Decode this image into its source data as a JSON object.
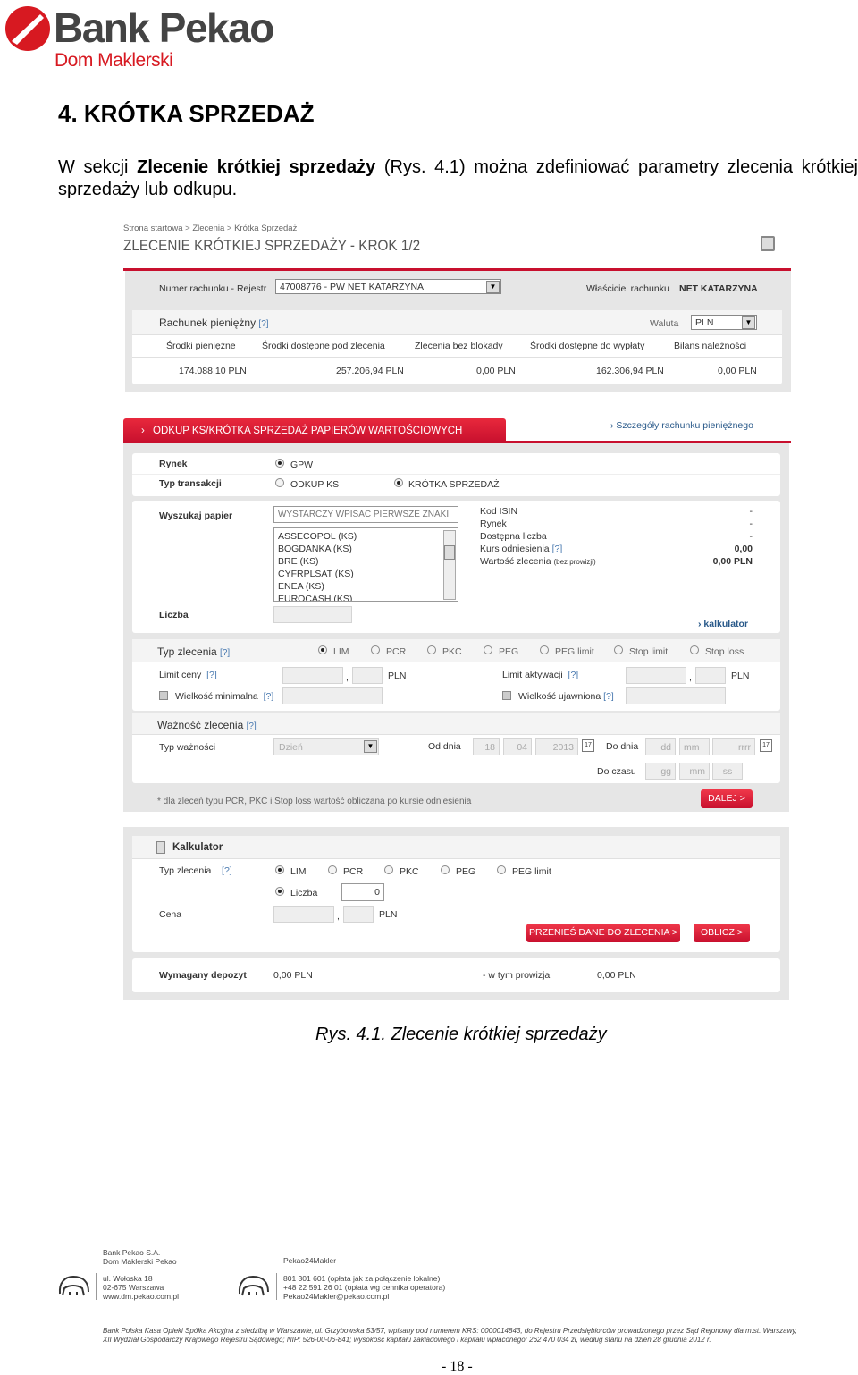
{
  "logo": {
    "brand": "Bank Pekao",
    "sub": "Dom Maklerski",
    "brand_color": "#d71921"
  },
  "heading": "4. KRÓTKA SPRZEDAŻ",
  "intro": {
    "pre": "W sekcji ",
    "bold": "Zlecenie krótkiej sprzedaży",
    "post": " (Rys. 4.1) można zdefiniować parametry zlecenia krótkiej sprzedaży lub odkupu."
  },
  "screen": {
    "breadcrumb": "Strona startowa > Zlecenia > Krótka Sprzedaż",
    "title": "ZLECENIE KRÓTKIEJ SPRZEDAŻY - KROK 1/2",
    "account": {
      "label": "Numer rachunku - Rejestr",
      "value": "47008776 - PW NET KATARZYNA",
      "owner_label": "Właściciel rachunku",
      "owner": "NET KATARZYNA"
    },
    "cash": {
      "title": "Rachunek pieniężny",
      "help": "[?]",
      "currency_label": "Waluta",
      "currency": "PLN",
      "columns": [
        "Środki pieniężne",
        "Środki dostępne pod zlecenia",
        "Zlecenia bez blokady",
        "Środki dostępne do wypłaty",
        "Bilans należności"
      ],
      "values": [
        "174.088,10  PLN",
        "257.206,94  PLN",
        "0,00  PLN",
        "162.306,94  PLN",
        "0,00  PLN"
      ]
    },
    "section_tab": "ODKUP KS/KRÓTKA SPRZEDAŻ PAPIERÓW WARTOŚCIOWYCH",
    "details_link": "Szczegóły rachunku pieniężnego",
    "market": {
      "label": "Rynek",
      "option": "GPW"
    },
    "transaction": {
      "label": "Typ transakcji",
      "options": [
        "ODKUP KS",
        "KRÓTKA SPRZEDAŻ"
      ],
      "selected": "KRÓTKA SPRZEDAŻ"
    },
    "search": {
      "label": "Wyszukaj papier",
      "placeholder": "WYSTARCZY WPISAĆ PIERWSZE ZNAKI",
      "list": [
        "ASSECOPOL (KS)",
        "BOGDANKA (KS)",
        "BRE (KS)",
        "CYFRPLSAT (KS)",
        "ENEA (KS)",
        "EUROCASH (KS)"
      ]
    },
    "info": {
      "isin": "Kod ISIN",
      "market": "Rynek",
      "available": "Dostępna liczba",
      "ref": "Kurs odniesienia",
      "value": "Wartość zlecenia",
      "value_note": "(bez prowizji)",
      "isin_v": "-",
      "market_v": "-",
      "available_v": "-",
      "ref_v": "0,00",
      "value_v": "0,00 PLN"
    },
    "quantity_label": "Liczba",
    "calc_link": "kalkulator",
    "order_type": {
      "label": "Typ zlecenia",
      "options": [
        "LIM",
        "PCR",
        "PKC",
        "PEG",
        "PEG limit",
        "Stop limit",
        "Stop loss"
      ],
      "selected": "LIM"
    },
    "limit": {
      "label": "Limit ceny",
      "unit": "PLN",
      "act_label": "Limit aktywacji",
      "min_label": "Wielkość minimalna",
      "shown_label": "Wielkość ujawniona",
      "comma": ","
    },
    "validity": {
      "title": "Ważność zlecenia",
      "type_label": "Typ ważności",
      "type": "Dzień",
      "from_label": "Od dnia",
      "from_d": "18",
      "from_m": "04",
      "from_y": "2013",
      "to_label": "Do dnia",
      "to_d": "dd",
      "to_m": "mm",
      "to_y": "rrrr",
      "time_label": "Do czasu",
      "hh": "gg",
      "mi": "mm",
      "ss": "ss",
      "cal": "17"
    },
    "footnote": "* dla zleceń typu PCR, PKC i Stop loss wartość obliczana po kursie odniesienia",
    "next_button": "DALEJ >",
    "calculator": {
      "title": "Kalkulator",
      "type_label": "Typ zlecenia",
      "options": [
        "LIM",
        "PCR",
        "PKC",
        "PEG",
        "PEG limit"
      ],
      "qty_label": "Liczba",
      "qty": "0",
      "price_label": "Cena",
      "unit": "PLN",
      "transfer_button": "PRZENIEŚ DANE DO ZLECENIA >",
      "calc_button": "OBLICZ >"
    },
    "deposit": {
      "label": "Wymagany depozyt",
      "value": "0,00  PLN",
      "fee_label": "- w tym prowizja",
      "fee": "0,00  PLN"
    }
  },
  "caption": "Rys. 4.1. Zlecenie krótkiej sprzedaży",
  "footer": {
    "col1": [
      "Bank Pekao S.A.",
      "Dom Maklerski Pekao",
      "ul. Wołoska 18",
      "02-675 Warszawa",
      "www.dm.pekao.com.pl"
    ],
    "col2": [
      "Pekao24Makler",
      "801 301 601 (opłata jak za połączenie lokalne)",
      "+48 22 591 26 01 (opłata wg cennika operatora)",
      "Pekao24Makler@pekao.com.pl"
    ],
    "legal": [
      "Bank Polska Kasa Opieki Spółka Akcyjna z siedzibą w Warszawie, ul. Grzybowska 53/57, wpisany pod numerem KRS: 0000014843, do Rejestru Przedsiębiorców prowadzonego przez Sąd Rejonowy dla m.st. Warszawy,",
      "XII Wydział Gospodarczy Krajowego Rejestru Sądowego; NIP: 526-00-06-841; wysokość kapitału zakładowego i kapitału wpłaconego: 262 470 034 zł, według stanu na dzień 28 grudnia 2012 r."
    ],
    "page": "- 18 -"
  }
}
